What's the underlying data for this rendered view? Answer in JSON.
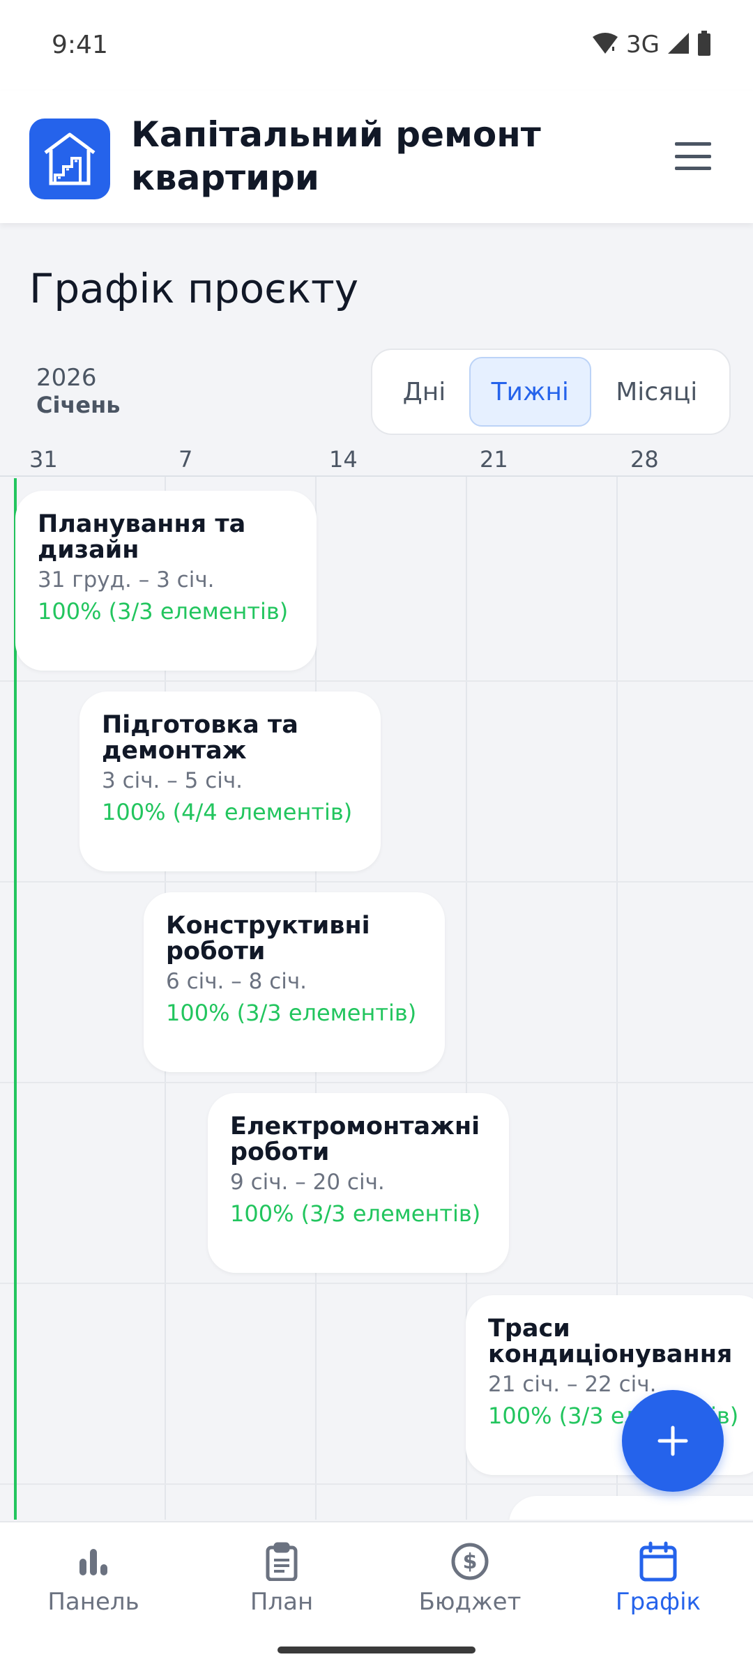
{
  "status": {
    "time": "9:41",
    "network": "3G"
  },
  "header": {
    "title": "Капітальний ремонт квартири"
  },
  "page": {
    "title": "Графік проєкту"
  },
  "calendar": {
    "year": "2026",
    "month": "Січень"
  },
  "view_modes": {
    "days": "Дні",
    "weeks": "Тижні",
    "months": "Місяці",
    "selected": "Тижні"
  },
  "weeks": [
    "31",
    "7",
    "14",
    "21",
    "28"
  ],
  "tasks": [
    {
      "name": "Планування та дизайн",
      "dates": "31 груд. – 3 січ.",
      "progress": "100% (3/3 елементів)"
    },
    {
      "name": "Підготовка та демонтаж",
      "dates": "3 січ. – 5 січ.",
      "progress": "100% (4/4 елементів)"
    },
    {
      "name": "Конструктивні роботи",
      "dates": "6 січ. – 8 січ.",
      "progress": "100% (3/3 елементів)"
    },
    {
      "name": "Електромонтажні роботи",
      "dates": "9 січ. – 20 січ.",
      "progress": "100% (3/3 елементів)"
    },
    {
      "name": "Траси кондиціонування",
      "dates": "21 січ. – 22 січ.",
      "progress": "100% (3/3 елементів)"
    }
  ],
  "colors": {
    "accent": "#2563eb",
    "progress": "#22c55e",
    "today_line": "#22c55e"
  },
  "nav": [
    {
      "label": "Панель",
      "icon": "bar-chart-icon"
    },
    {
      "label": "План",
      "icon": "clipboard-icon"
    },
    {
      "label": "Бюджет",
      "icon": "dollar-circle-icon"
    },
    {
      "label": "Графік",
      "icon": "calendar-icon",
      "active": true
    }
  ]
}
